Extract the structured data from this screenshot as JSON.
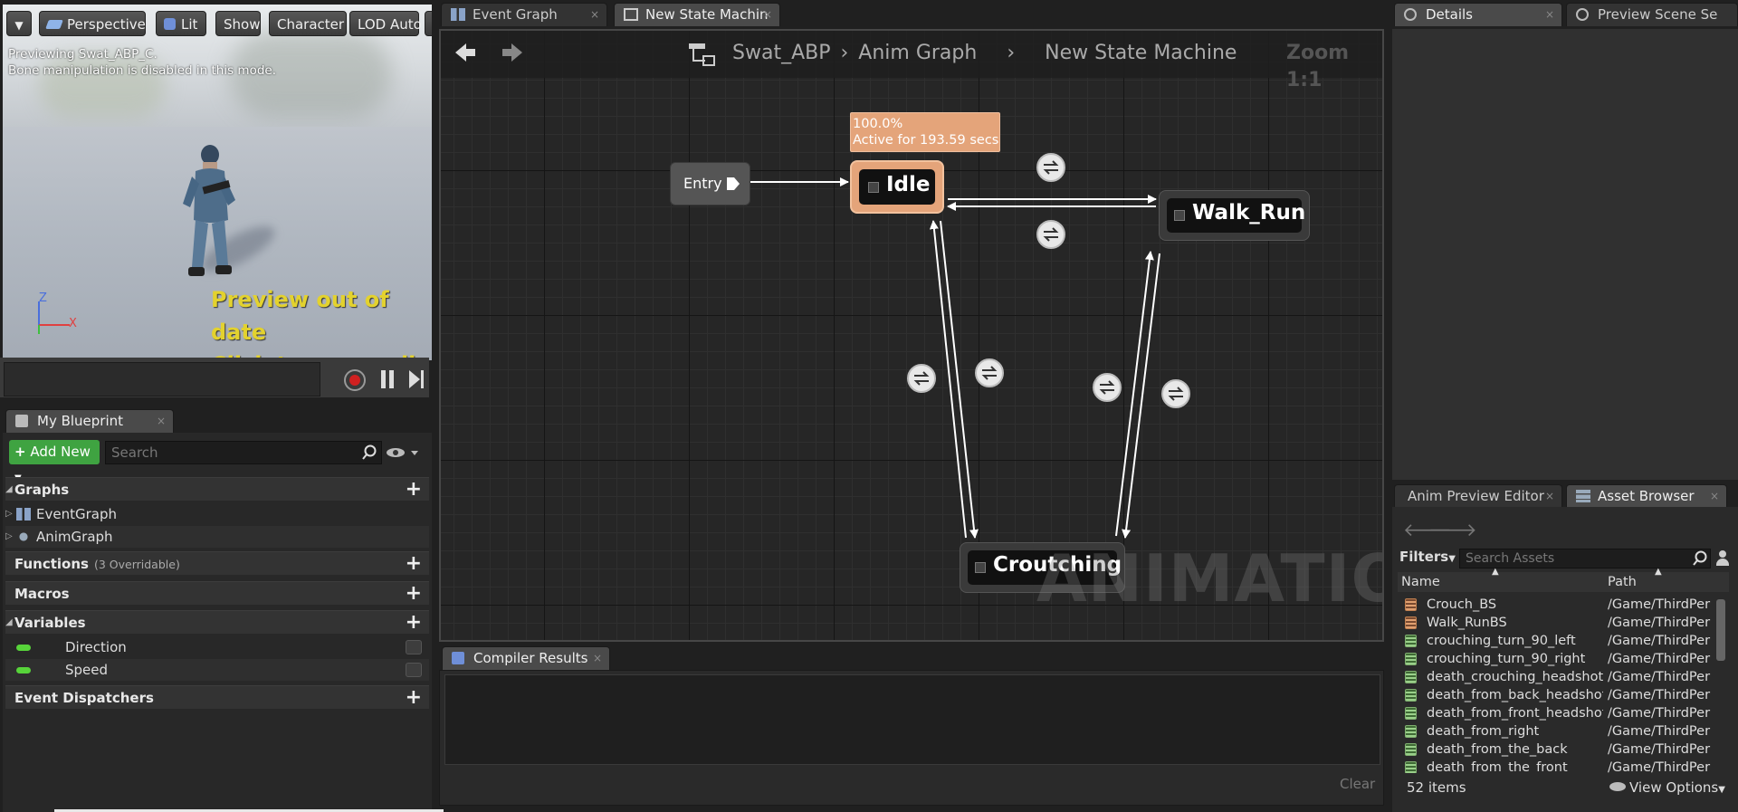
{
  "viewport": {
    "buttons": {
      "perspective": "Perspective",
      "lit": "Lit",
      "show": "Show",
      "character": "Character",
      "lod": "LOD Auto"
    },
    "info_line1": "Previewing Swat_ABP_C.",
    "info_line2": "Bone manipulation is disabled in this mode.",
    "warn_line1": "Preview out of date",
    "warn_line2": "Click to recompile",
    "axis_z": "Z",
    "axis_x": "X"
  },
  "tabs": {
    "event_graph": "Event Graph",
    "state_machine": "New State Machin",
    "details": "Details",
    "preview_scene": "Preview Scene Se",
    "my_blueprint": "My Blueprint",
    "compiler_results": "Compiler Results",
    "anim_preview_editor": "Anim Preview Editor",
    "asset_browser": "Asset Browser"
  },
  "my_blueprint": {
    "add_new": "Add New",
    "search_placeholder": "Search",
    "graphs_label": "Graphs",
    "graph_items": [
      "EventGraph",
      "AnimGraph"
    ],
    "functions_label": "Functions",
    "functions_sub": "(3 Overridable)",
    "macros_label": "Macros",
    "variables_label": "Variables",
    "variables": [
      "Direction",
      "Speed"
    ],
    "event_dispatchers_label": "Event Dispatchers"
  },
  "graph": {
    "breadcrumb": [
      "Swat_ABP",
      "Anim Graph",
      "New State Machine"
    ],
    "zoom": "Zoom 1:1",
    "watermark": "ANIMATION",
    "entry_label": "Entry",
    "states": {
      "idle": "Idle",
      "walk_run": "Walk_Run",
      "crouching": "Croutching"
    },
    "tooltip_line1": "100.0%",
    "tooltip_line2": "Active for 193.59 secs"
  },
  "compiler": {
    "clear": "Clear"
  },
  "asset_browser": {
    "filters": "Filters",
    "search_placeholder": "Search Assets",
    "col_name": "Name",
    "col_path": "Path",
    "rows": [
      {
        "name": "Crouch_BS",
        "path": "/Game/ThirdPer",
        "kind": "blendspace"
      },
      {
        "name": "Walk_RunBS",
        "path": "/Game/ThirdPer",
        "kind": "blendspace"
      },
      {
        "name": "crouching_turn_90_left",
        "path": "/Game/ThirdPer",
        "kind": "sequence"
      },
      {
        "name": "crouching_turn_90_right",
        "path": "/Game/ThirdPer",
        "kind": "sequence"
      },
      {
        "name": "death_crouching_headshot_",
        "path": "/Game/ThirdPer",
        "kind": "sequence"
      },
      {
        "name": "death_from_back_headshot",
        "path": "/Game/ThirdPer",
        "kind": "sequence"
      },
      {
        "name": "death_from_front_headshot",
        "path": "/Game/ThirdPer",
        "kind": "sequence"
      },
      {
        "name": "death_from_right",
        "path": "/Game/ThirdPer",
        "kind": "sequence"
      },
      {
        "name": "death_from_the_back",
        "path": "/Game/ThirdPer",
        "kind": "sequence"
      },
      {
        "name": "death_from_the_front",
        "path": "/Game/ThirdPer",
        "kind": "sequence"
      }
    ],
    "item_count": "52 items",
    "view_options": "View Options"
  }
}
